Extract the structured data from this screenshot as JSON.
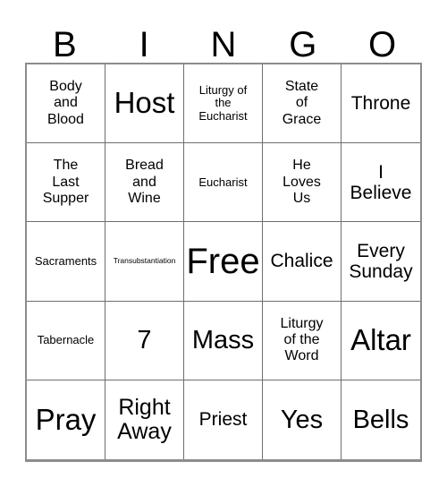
{
  "card": {
    "title": "BINGO Card",
    "header_letters": [
      "B",
      "I",
      "N",
      "G",
      "O"
    ],
    "colors": {
      "background": "#ffffff",
      "text": "#000000",
      "grid_line": "#6e6e6e",
      "grid_border": "#8c8c8c"
    },
    "grid": {
      "rows": 5,
      "columns": 5,
      "free_space_index": 12,
      "cells": [
        {
          "text": "Body\nand\nBlood",
          "size": "s-sm"
        },
        {
          "text": "Host",
          "size": "s-2xl"
        },
        {
          "text": "Liturgy of\nthe\nEucharist",
          "size": "s-xs"
        },
        {
          "text": "State\nof\nGrace",
          "size": "s-sm"
        },
        {
          "text": "Throne",
          "size": "s-md"
        },
        {
          "text": "The\nLast\nSupper",
          "size": "s-sm"
        },
        {
          "text": "Bread\nand\nWine",
          "size": "s-sm"
        },
        {
          "text": "Eucharist",
          "size": "s-xs"
        },
        {
          "text": "He\nLoves\nUs",
          "size": "s-sm"
        },
        {
          "text": "I\nBelieve",
          "size": "s-md"
        },
        {
          "text": "Sacraments",
          "size": "s-xs"
        },
        {
          "text": "Transubstantiation",
          "size": "s-xxs"
        },
        {
          "text": "Free",
          "size": "s-3xl"
        },
        {
          "text": "Chalice",
          "size": "s-md"
        },
        {
          "text": "Every\nSunday",
          "size": "s-md"
        },
        {
          "text": "Tabernacle",
          "size": "s-xs"
        },
        {
          "text": "7",
          "size": "s-xl"
        },
        {
          "text": "Mass",
          "size": "s-xl"
        },
        {
          "text": "Liturgy\nof the\nWord",
          "size": "s-sm"
        },
        {
          "text": "Altar",
          "size": "s-2xl"
        },
        {
          "text": "Pray",
          "size": "s-2xl"
        },
        {
          "text": "Right\nAway",
          "size": "s-lg"
        },
        {
          "text": "Priest",
          "size": "s-md"
        },
        {
          "text": "Yes",
          "size": "s-xl"
        },
        {
          "text": "Bells",
          "size": "s-xl"
        }
      ]
    }
  }
}
